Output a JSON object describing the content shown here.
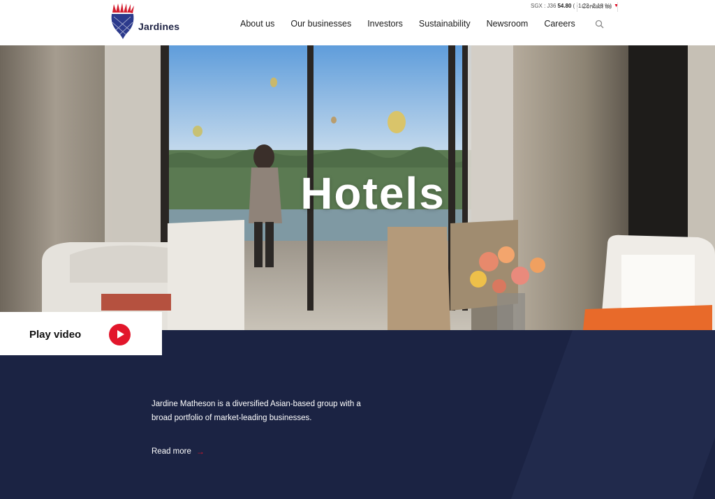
{
  "header": {
    "logo_text": "Jardines",
    "stock": {
      "exchange": "SGX : J36",
      "price": "54.80",
      "change": "( -1.22 -2.18 %)"
    },
    "contact_label": "Contact us",
    "nav": [
      "About us",
      "Our businesses",
      "Investors",
      "Sustainability",
      "Newsroom",
      "Careers"
    ]
  },
  "hero": {
    "title": "Hotels"
  },
  "video": {
    "label": "Play video"
  },
  "intro": {
    "text": "Jardine Matheson is a diversified Asian-based group with a broad portfolio of market-leading businesses.",
    "read_more": "Read more"
  },
  "colors": {
    "navy": "#1b2343",
    "accent_red": "#e2162b"
  },
  "icons": {
    "search": "search-icon",
    "play": "play-icon",
    "arrow": "arrow-right-icon"
  }
}
